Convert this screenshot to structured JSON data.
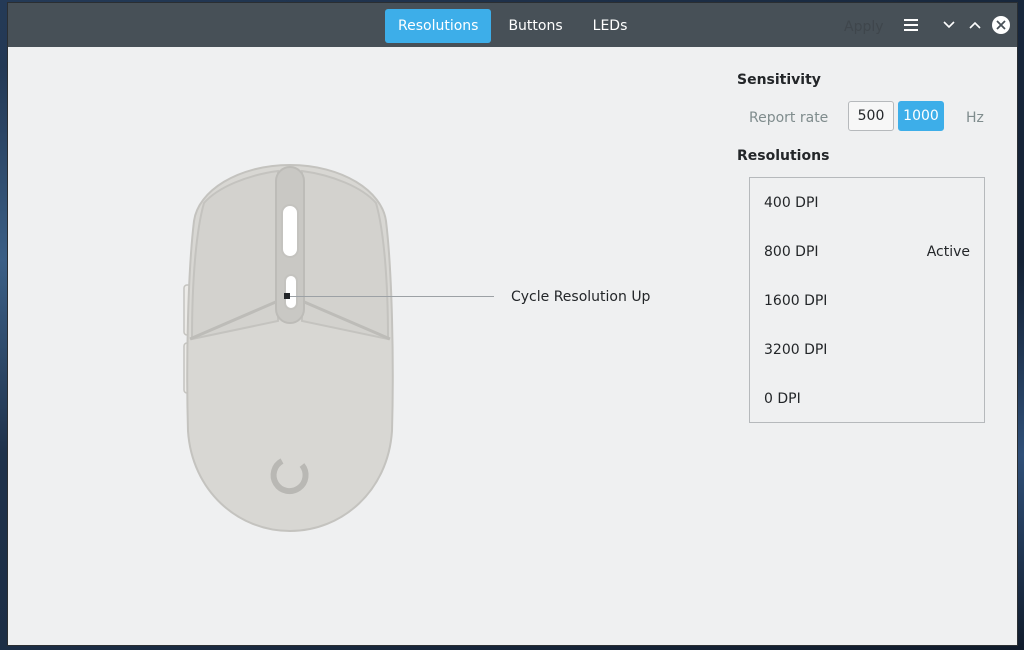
{
  "titlebar": {
    "tabs": [
      {
        "label": "Resolutions",
        "active": true
      },
      {
        "label": "Buttons",
        "active": false
      },
      {
        "label": "LEDs",
        "active": false
      }
    ],
    "apply_label": "Apply",
    "icons": [
      "hamburger-menu-icon",
      "minimize-icon",
      "maximize-icon",
      "close-icon"
    ]
  },
  "mouse": {
    "callout_label": "Cycle Resolution Up"
  },
  "sensitivity": {
    "title": "Sensitivity",
    "report_rate_label": "Report rate",
    "rates": [
      {
        "label": "500",
        "selected": false
      },
      {
        "label": "1000",
        "selected": true
      }
    ],
    "unit": "Hz"
  },
  "resolutions": {
    "title": "Resolutions",
    "items": [
      {
        "label": "400 DPI",
        "status": ""
      },
      {
        "label": "800 DPI",
        "status": "Active"
      },
      {
        "label": "1600 DPI",
        "status": ""
      },
      {
        "label": "3200 DPI",
        "status": ""
      },
      {
        "label": "0 DPI",
        "status": ""
      }
    ]
  },
  "colors": {
    "accent": "#3daee9",
    "titlebar": "#475057",
    "window_bg": "#eff0f1",
    "mouse_body": "#d8d7d3"
  }
}
